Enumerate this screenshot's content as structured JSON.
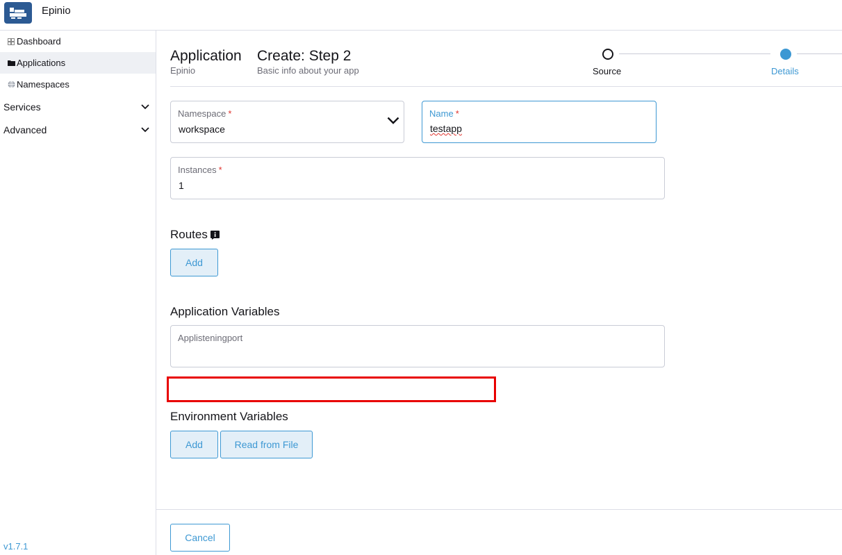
{
  "app": {
    "title": "Epinio",
    "logo_icon": "epinio-logo-icon"
  },
  "sidebar": {
    "items": [
      {
        "label": "Dashboard",
        "icon": "grid-icon"
      },
      {
        "label": "Applications",
        "icon": "folder-icon"
      },
      {
        "label": "Namespaces",
        "icon": "globe-icon"
      }
    ],
    "groups": [
      {
        "label": "Services"
      },
      {
        "label": "Advanced"
      }
    ],
    "version": "v1.7.1"
  },
  "header": {
    "title": "Application",
    "subtitle": "Epinio",
    "step_title": "Create: Step 2",
    "step_subtitle": "Basic info about your app"
  },
  "stepper": {
    "steps": [
      {
        "label": "Source",
        "state": "done"
      },
      {
        "label": "Details",
        "state": "current"
      }
    ]
  },
  "form": {
    "namespace": {
      "label": "Namespace",
      "required": "*",
      "value": "workspace"
    },
    "name": {
      "label": "Name",
      "required": "*",
      "value": "testapp"
    },
    "instances": {
      "label": "Instances",
      "required": "*",
      "value": "1"
    }
  },
  "routes": {
    "title": "Routes",
    "add_label": "Add"
  },
  "app_vars": {
    "title": "Application Variables",
    "field_label": "Applisteningport"
  },
  "env_vars": {
    "title": "Environment Variables",
    "add_label": "Add",
    "read_label": "Read from File"
  },
  "footer": {
    "cancel_label": "Cancel"
  },
  "colors": {
    "accent": "#3d98d3",
    "brand": "#2c5a93",
    "required": "#e0342e",
    "highlight": "#e80000"
  }
}
